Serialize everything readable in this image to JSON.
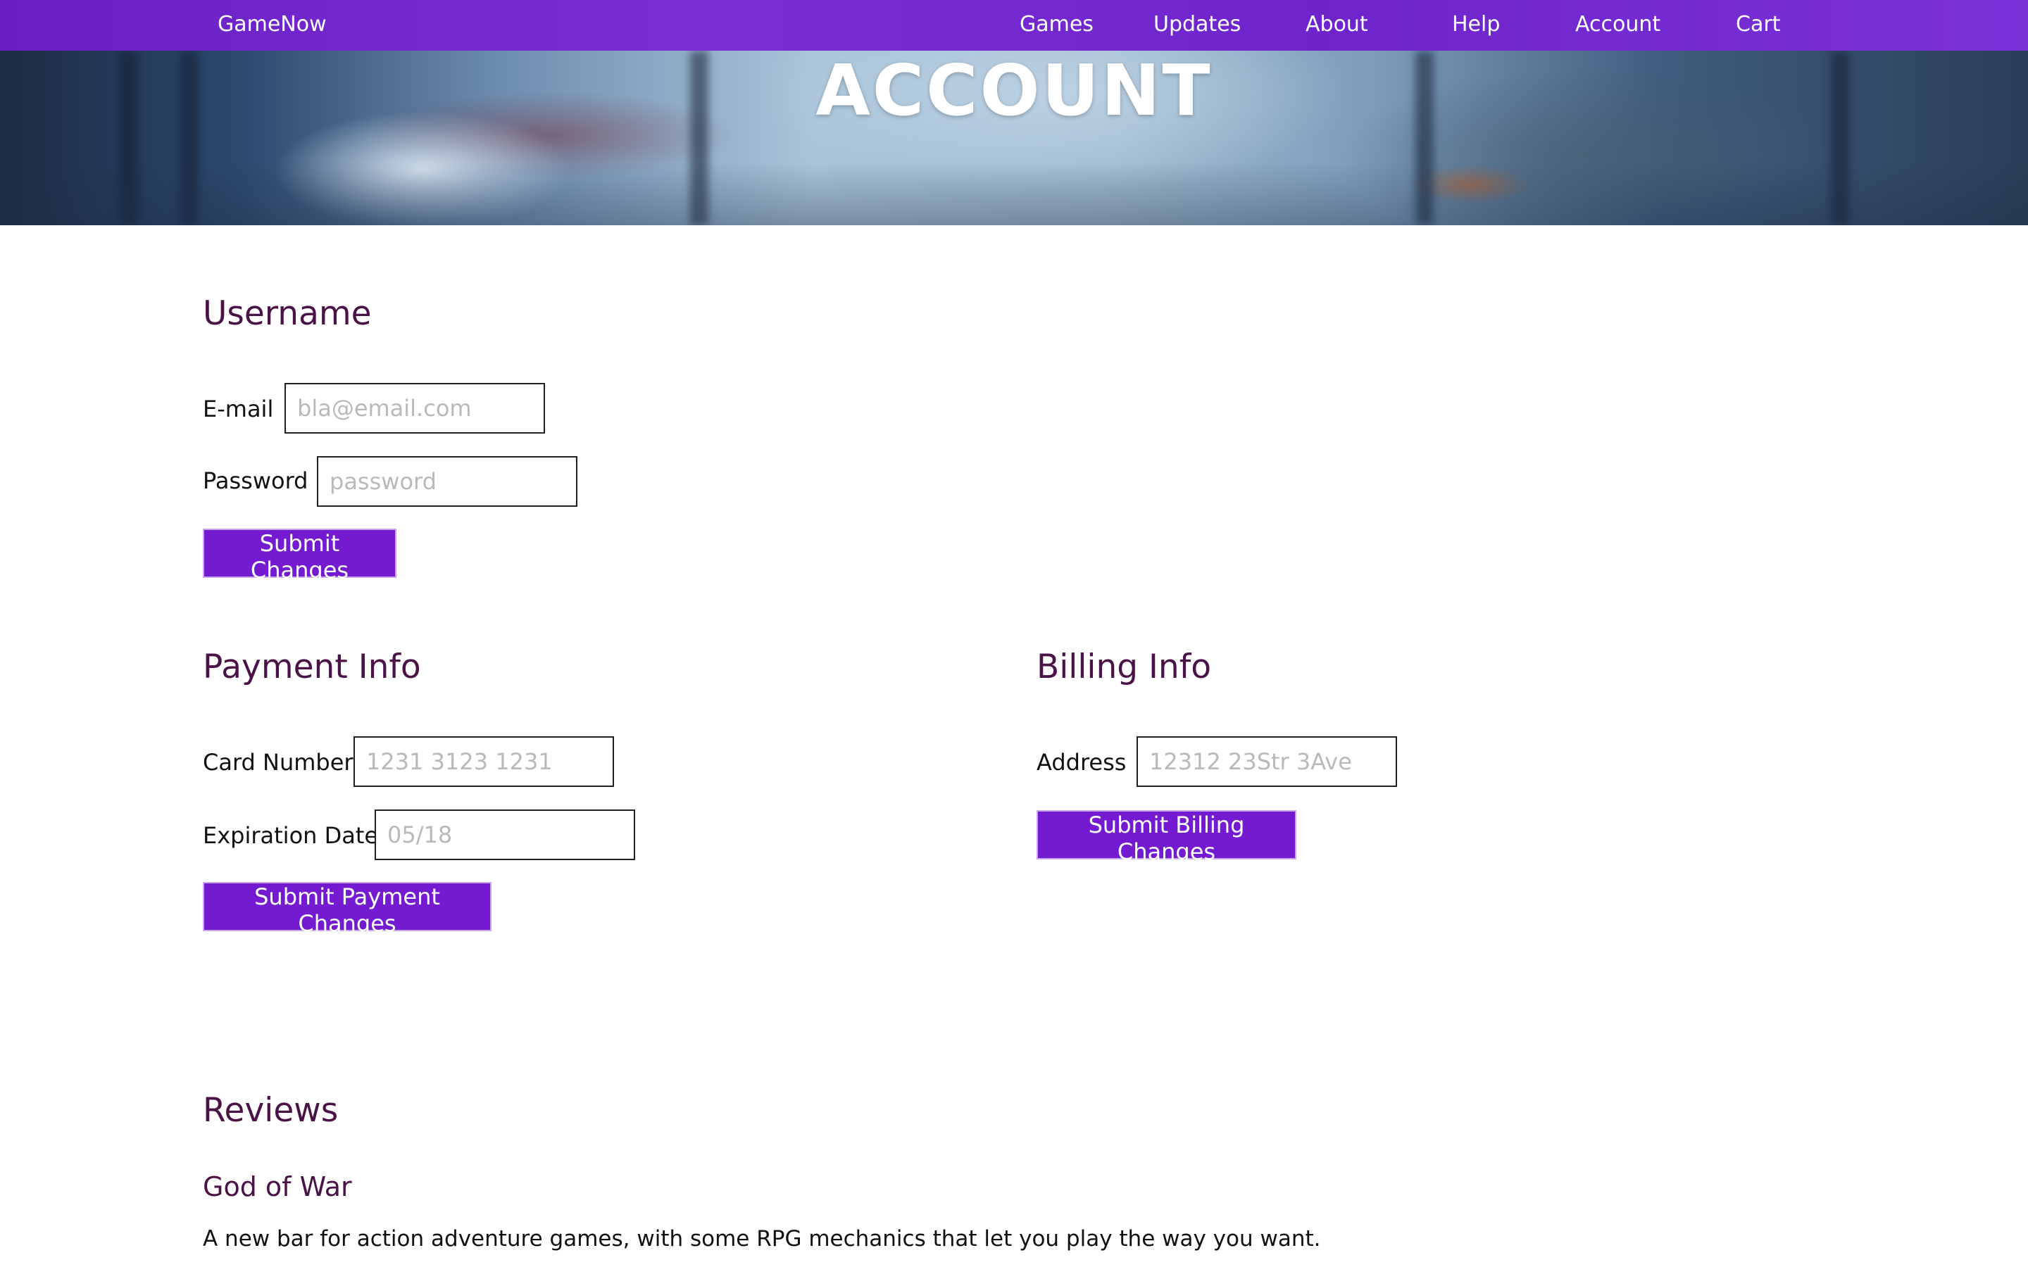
{
  "nav": {
    "brand": "GameNow",
    "links": [
      "Games",
      "Updates",
      "About",
      "Help",
      "Account",
      "Cart"
    ]
  },
  "hero": {
    "title": "ACCOUNT"
  },
  "username_section": {
    "title": "Username",
    "email_label": "E-mail",
    "email_placeholder": "bla@email.com",
    "password_label": "Password",
    "password_placeholder": "password",
    "submit_label": "Submit Changes"
  },
  "payment_section": {
    "title": "Payment Info",
    "card_label": "Card Number",
    "card_placeholder": "1231 3123 1231",
    "exp_label": "Expiration Date",
    "exp_placeholder": "05/18",
    "submit_label": "Submit Payment Changes"
  },
  "billing_section": {
    "title": "Billing Info",
    "address_label": "Address",
    "address_placeholder": "12312 23Str 3Ave",
    "submit_label": "Submit Billing Changes"
  },
  "reviews": {
    "title": "Reviews",
    "items": [
      {
        "game": "God of War",
        "text": "A new bar for action adventure games, with some RPG mechanics that let you play the way you want."
      }
    ]
  },
  "colors": {
    "nav_purple": "#6f24cb",
    "button_purple": "#741ad0",
    "heading_plum": "#4a1246"
  }
}
